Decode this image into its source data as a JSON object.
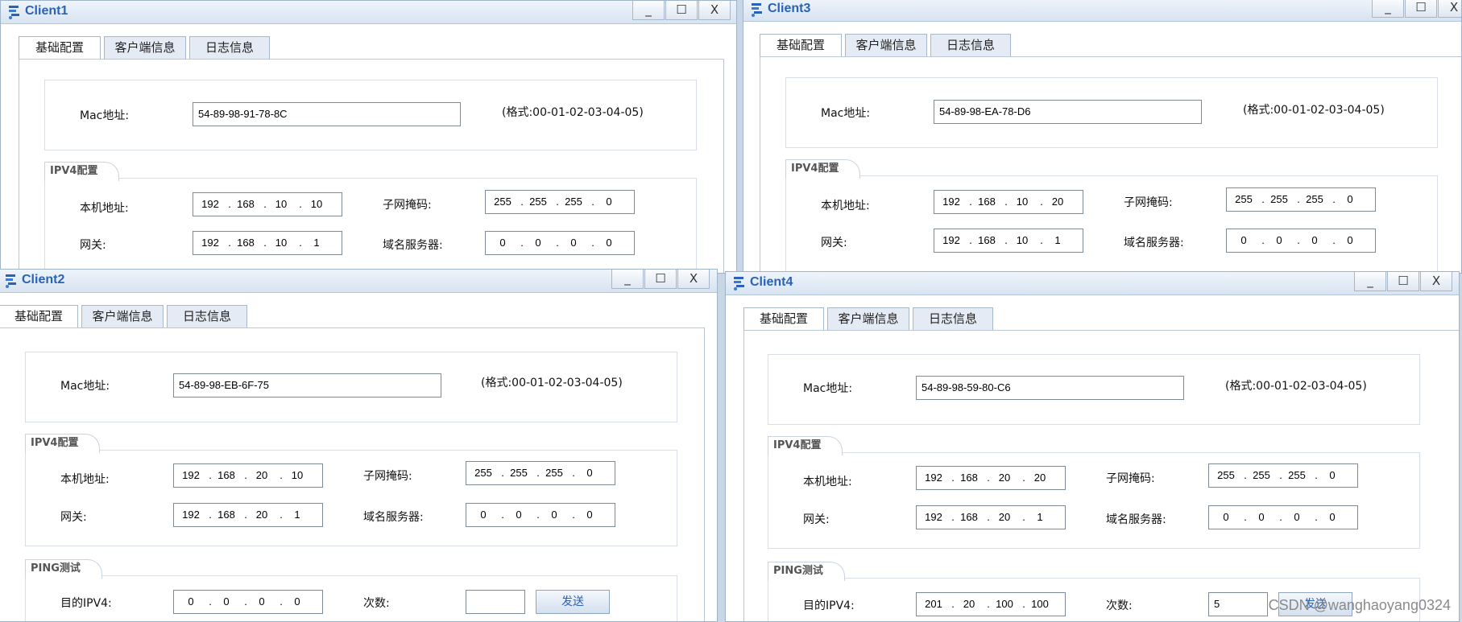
{
  "tabs": {
    "basic": "基础配置",
    "client_info": "客户端信息",
    "log_info": "日志信息"
  },
  "labels": {
    "mac": "Mac地址:",
    "mac_hint": "(格式:00-01-02-03-04-05)",
    "ipv4_section": "IPV4配置",
    "local_ip": "本机地址:",
    "subnet": "子网掩码:",
    "gateway": "网关:",
    "dns": "域名服务器:",
    "ping_section": "PING测试",
    "target_ipv4": "目的IPV4:",
    "count": "次数:",
    "send": "发送"
  },
  "window_controls": {
    "minimize": "_",
    "maximize": "☐",
    "close": "X"
  },
  "clients": {
    "c1": {
      "title": "Client1",
      "mac": "54-89-98-91-78-8C",
      "ip": [
        "192",
        "168",
        "10",
        "10"
      ],
      "mask": [
        "255",
        "255",
        "255",
        "0"
      ],
      "gw": [
        "192",
        "168",
        "10",
        "1"
      ],
      "dns": [
        "0",
        "0",
        "0",
        "0"
      ]
    },
    "c3": {
      "title": "Client3",
      "mac": "54-89-98-EA-78-D6",
      "ip": [
        "192",
        "168",
        "10",
        "20"
      ],
      "mask": [
        "255",
        "255",
        "255",
        "0"
      ],
      "gw": [
        "192",
        "168",
        "10",
        "1"
      ],
      "dns": [
        "0",
        "0",
        "0",
        "0"
      ]
    },
    "c2": {
      "title": "Client2",
      "mac": "54-89-98-EB-6F-75",
      "ip": [
        "192",
        "168",
        "20",
        "10"
      ],
      "mask": [
        "255",
        "255",
        "255",
        "0"
      ],
      "gw": [
        "192",
        "168",
        "20",
        "1"
      ],
      "dns": [
        "0",
        "0",
        "0",
        "0"
      ],
      "ping": {
        "target": [
          "0",
          "0",
          "0",
          "0"
        ],
        "count": ""
      }
    },
    "c4": {
      "title": "Client4",
      "mac": "54-89-98-59-80-C6",
      "ip": [
        "192",
        "168",
        "20",
        "20"
      ],
      "mask": [
        "255",
        "255",
        "255",
        "0"
      ],
      "gw": [
        "192",
        "168",
        "20",
        "1"
      ],
      "dns": [
        "0",
        "0",
        "0",
        "0"
      ],
      "ping": {
        "target": [
          "201",
          "20",
          "100",
          "100"
        ],
        "count": "5"
      }
    }
  },
  "watermark": "CSDN @wanghaoyang0324",
  "colors": {
    "title_text": "#2a62b7",
    "titlebar": "#d8e4f1",
    "tab_inactive": "#e4ebf4"
  }
}
